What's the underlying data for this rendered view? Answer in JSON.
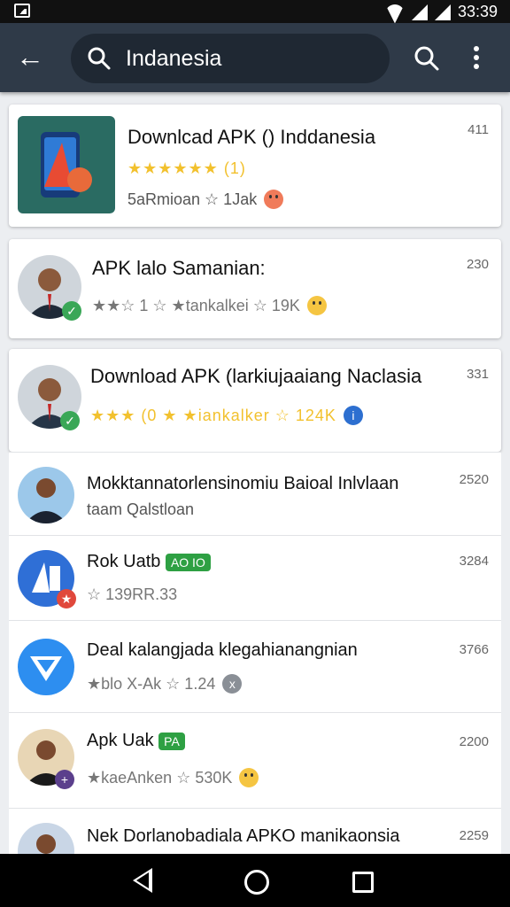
{
  "status_bar": {
    "time": "33:39",
    "icons": [
      "image-icon",
      "wifi-icon",
      "signal-icon",
      "signal-icon"
    ]
  },
  "app_bar": {
    "search_text": "Indanesia",
    "back_icon": "arrow-left-icon",
    "search_icon": "search-icon",
    "more_icon": "more-vert-icon"
  },
  "results": [
    {
      "title": "Downlcad APK () Inddanesia",
      "line2": "★★★★★★ (1)",
      "line3": "5aRmioan ☆ 1Jak",
      "count": "411"
    },
    {
      "title": "APK lalo Samanian:",
      "line2": "★★☆ 1 ☆ ★tankalkei ☆ 19K",
      "count": "230"
    },
    {
      "title": "Download APK (larkiujaaiang Naclasia",
      "line2": "★★★ (0 ★ ★iankalker ☆ 124K",
      "count": "331"
    },
    {
      "title": "Mokktannatorlensinomiu Baioal Inlvlaan",
      "line2": "taam Qalstloan",
      "count": "2520"
    },
    {
      "title": "Rok Uatb",
      "chip": "AO IO",
      "line2": "☆ 139RR.33",
      "count": "3284"
    },
    {
      "title": "Deal kalangjada klegahianangnian",
      "line2": "★blo X-Ak ☆ 1.24",
      "count": "3766"
    },
    {
      "title": "Apk Uak",
      "chip": "PA",
      "line2": "★kaeAnken ☆ 530K",
      "count": "2200"
    },
    {
      "title": "Nek Dorlanobadiala APKO manikaonsia",
      "count": "2259"
    }
  ],
  "nav": {
    "back": "nav-back-icon",
    "home": "nav-home-icon",
    "recents": "nav-recents-icon"
  },
  "colors": {
    "app_bar": "#2f3a48",
    "star": "#f2c12e",
    "chip_green": "#2ea043"
  }
}
